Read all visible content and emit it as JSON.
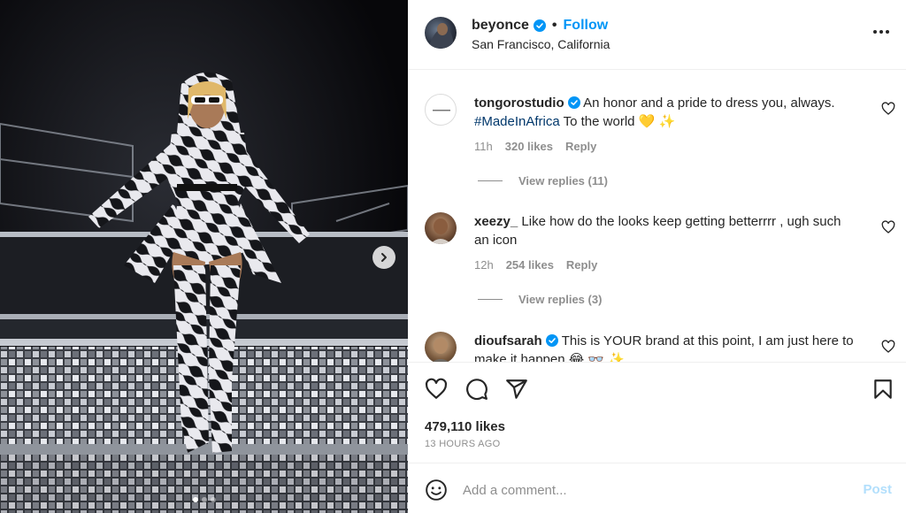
{
  "post": {
    "username": "beyonce",
    "separator": "•",
    "follow_label": "Follow",
    "location": "San Francisco, California",
    "more_icon": "more-horizontal-icon"
  },
  "media": {
    "next_icon": "chevron-right-icon",
    "slide_count": 3,
    "active_slide": 1
  },
  "comments": [
    {
      "username": "tongorostudio",
      "text_before": "An honor and a pride to dress you, always.",
      "hashtag": "#MadeInAfrica",
      "text_after": "To the world 💛 ✨",
      "time": "11h",
      "likes": "320 likes",
      "reply_label": "Reply",
      "view_replies": "View replies (11)"
    },
    {
      "username": "xeezy_",
      "text": "Like how do the looks keep getting betterrrr , ugh such an icon",
      "time": "12h",
      "likes": "254 likes",
      "reply_label": "Reply",
      "view_replies": "View replies (3)"
    },
    {
      "username": "dioufsarah",
      "text": "This is YOUR brand at this point, I am just here to make it happen 😂 👓 ✨"
    }
  ],
  "actions": {
    "like_icon": "heart-icon",
    "comment_icon": "comment-icon",
    "share_icon": "share-icon",
    "save_icon": "bookmark-icon",
    "likes_count": "479,110 likes",
    "time_ago": "13 HOURS AGO"
  },
  "add_comment": {
    "placeholder": "Add a comment...",
    "post_label": "Post",
    "emoji_icon": "emoji-icon"
  },
  "colors": {
    "accent": "#0095f6",
    "post_disabled": "#b2dffc",
    "muted": "#8e8e8e",
    "text": "#262626"
  }
}
